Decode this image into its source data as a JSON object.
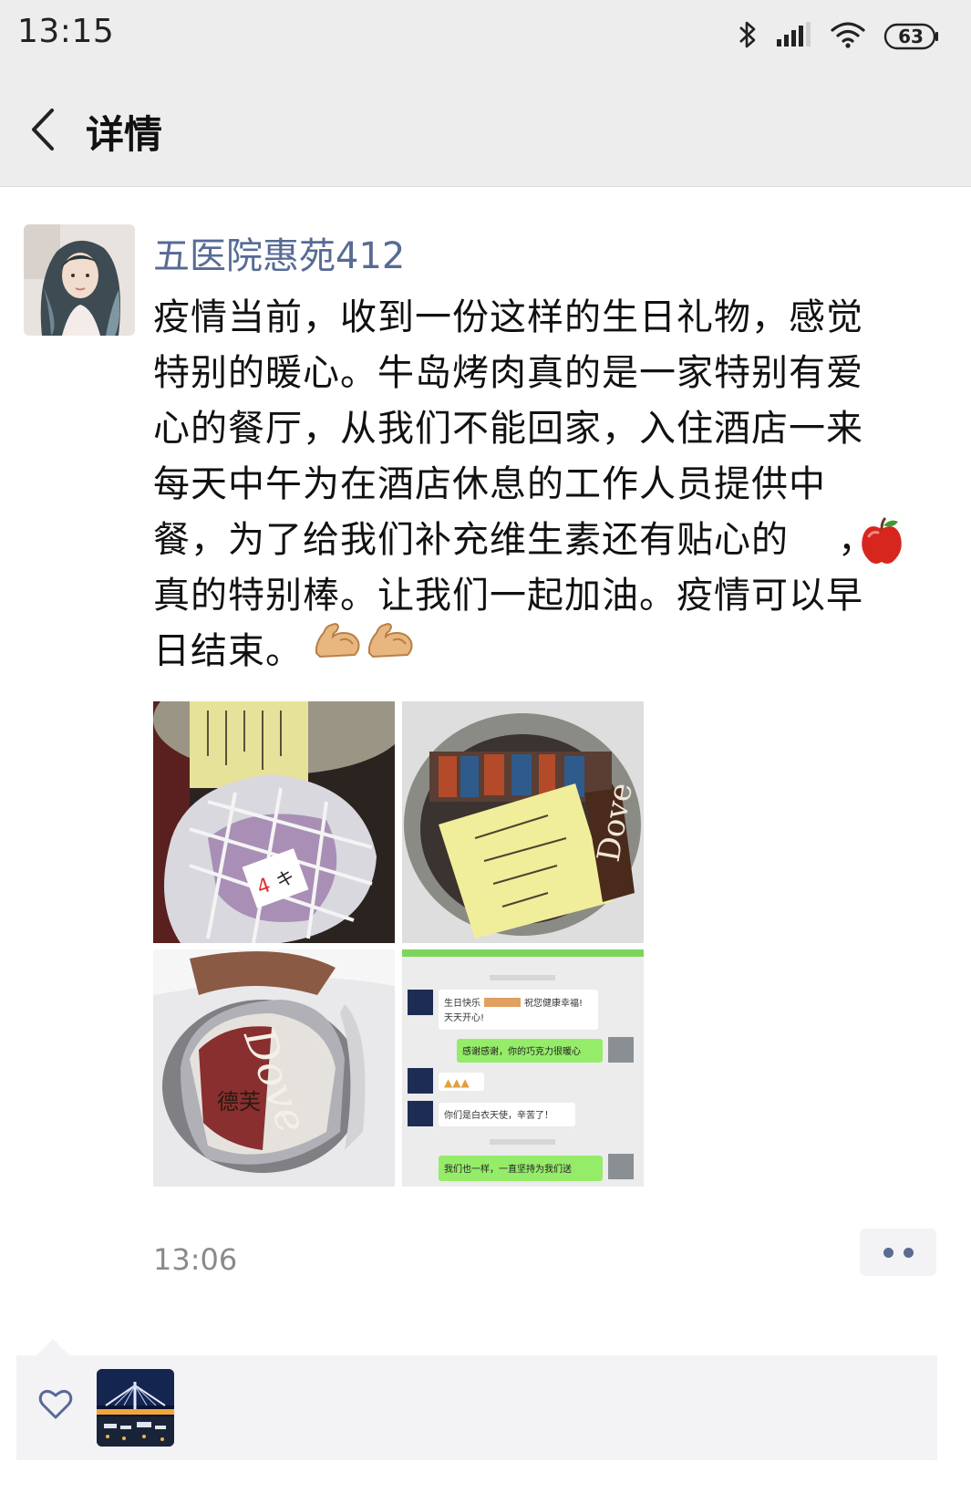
{
  "status_bar": {
    "time": "13:15",
    "battery": "63",
    "icons": [
      "bluetooth-icon",
      "signal-icon",
      "wifi-icon",
      "battery-icon"
    ]
  },
  "header": {
    "back_icon": "chevron-left-icon",
    "title": "详情"
  },
  "post": {
    "author": "五医院惠苑412",
    "text": "疫情当前，收到一份这样的生日礼物，感觉\n特别的暖心。牛岛烤肉真的是一家特别有爱\n心的餐厅，从我们不能回家，入住酒店一来\n每天中午为在酒店休息的工作人员提供中\n餐，为了给我们补充维生素还有贴心的",
    "text_tail": "，\n真的特别棒。让我们一起加油。疫情可以早\n日结束。",
    "emojis": [
      "apple",
      "flexed-biceps",
      "flexed-biceps"
    ],
    "photo_texts": {
      "chat_greeting": "生日快乐 祝您健康幸福！天天开心！",
      "chat_reply_1": "感谢感谢，你的巧克力很暖心",
      "chat_bubble_3": "你们是白衣天使，辛苦了！",
      "chat_reply_2": "我们也一样，一直坚持为我们送",
      "chocolate_brand": "德芙 Dove"
    },
    "time": "13:06"
  },
  "likes": {
    "heart_icon": "heart-outline-icon"
  },
  "colors": {
    "bar_bg": "#ededed",
    "author_link": "#576b95",
    "likes_bg": "#f3f3f5",
    "text": "#111111",
    "time_gray": "#8a8a8a"
  }
}
